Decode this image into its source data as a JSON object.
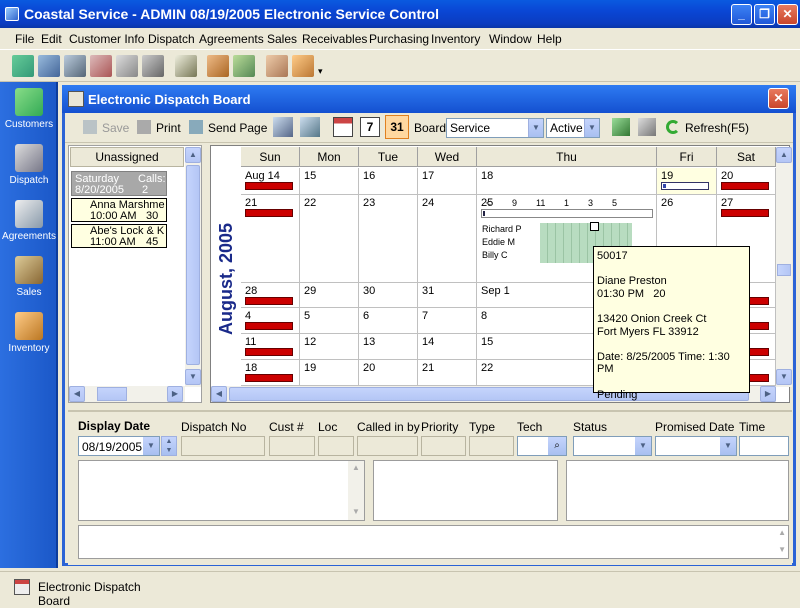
{
  "app": {
    "title": "Coastal Service - ADMIN 08/19/2005 Electronic Service Control",
    "window_buttons": [
      "_",
      "❐",
      "✕"
    ]
  },
  "menu": [
    "File",
    "Edit",
    "Customer Info",
    "Dispatch",
    "Agreements",
    "Sales",
    "Receivables",
    "Purchasing",
    "Inventory",
    "Window",
    "Help"
  ],
  "left_nav": [
    "Customers",
    "Dispatch",
    "Agreements",
    "Sales",
    "Inventory"
  ],
  "child_window": {
    "title": "Electronic Dispatch Board",
    "close": "✕"
  },
  "dispatch_toolbar": {
    "save": "Save",
    "print": "Print",
    "send_page": "Send Page",
    "cal7": "7",
    "cal31": "31",
    "board_label": "Board",
    "board_value": "Service",
    "status_value": "Active",
    "refresh": "Refresh(F5)"
  },
  "unassigned": {
    "header": "Unassigned",
    "day_label": "Saturday",
    "day_date": "8/20/2005",
    "calls_label": "Calls:",
    "calls_count": "2",
    "cards": [
      {
        "name": "Anna Marshme",
        "time": "10:00 AM",
        "value": "30"
      },
      {
        "name": "Abe's Lock & K",
        "time": "11:00 AM",
        "value": "45"
      }
    ]
  },
  "calendar": {
    "month_label": "August, 2005",
    "days": [
      "Sun",
      "Mon",
      "Tue",
      "Wed",
      "Thu",
      "Fri",
      "Sat"
    ],
    "weeks": [
      [
        "Aug 14",
        "15",
        "16",
        "17",
        "18",
        "19",
        "20"
      ],
      [
        "21",
        "22",
        "23",
        "24",
        "25",
        "26",
        "27"
      ],
      [
        "28",
        "29",
        "30",
        "31",
        "Sep 1",
        "2",
        "3"
      ],
      [
        "4",
        "5",
        "6",
        "7",
        "8",
        "9",
        "10"
      ],
      [
        "11",
        "12",
        "13",
        "14",
        "15",
        "16",
        "17"
      ],
      [
        "18",
        "19",
        "20",
        "21",
        "22",
        "23",
        "24"
      ]
    ],
    "thursday_25": {
      "hours": [
        "<",
        "9",
        "11",
        "1",
        "3",
        "5"
      ],
      "techs": [
        "Richard P",
        "Eddie M",
        "Billy C"
      ]
    }
  },
  "tooltip": {
    "id": "50017",
    "customer": "Diane Preston",
    "time": "01:30 PM",
    "duration": "20",
    "address1": "13420 Onion Creek Ct",
    "address2": "Fort Myers FL 33912",
    "date_line": "Date: 8/25/2005 Time: 1:30 PM",
    "status": "Pending"
  },
  "form": {
    "display_date_label": "Display Date",
    "display_date_value": "08/19/2005",
    "dispatch_no": "Dispatch No",
    "cust_no": "Cust #",
    "loc": "Loc",
    "called_in_by": "Called in by",
    "priority": "Priority",
    "type": "Type",
    "tech": "Tech",
    "status": "Status",
    "promised_date": "Promised Date",
    "time": "Time"
  },
  "taskbar": {
    "item": "Electronic Dispatch Board"
  },
  "colors": {
    "xp_blue": "#0a46d4",
    "nav_blue": "#2c6fe0",
    "schedule_red": "#cc0000",
    "tooltip_bg": "#ffffe1"
  }
}
